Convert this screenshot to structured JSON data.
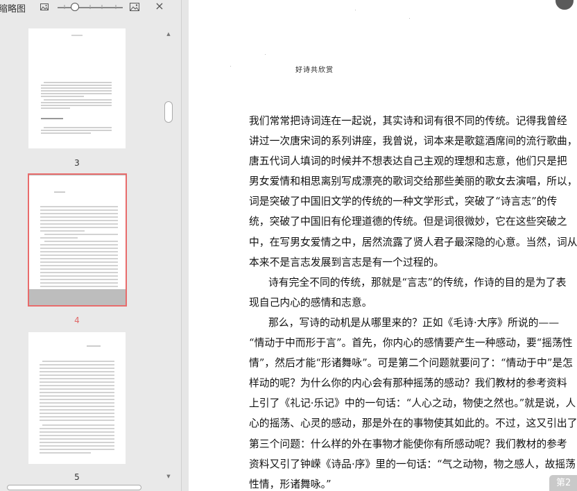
{
  "thumbnail_panel": {
    "title": "缩略图",
    "close_label": "×",
    "pages": [
      {
        "number": "3",
        "selected": false
      },
      {
        "number": "4",
        "selected": true
      },
      {
        "number": "5",
        "selected": false
      }
    ]
  },
  "document": {
    "running_header": "好诗共欣赏",
    "lines": [
      "我们常常把诗词连在一起说，其实诗和词有很不同的传统。记得我曾经",
      "讲过一次唐宋词的系列讲座，我曾说，词本来是歌筵酒席间的流行歌曲，",
      "唐五代词人填词的时候并不想表达自己主观的理想和志意，他们只是把",
      "男女爱情和相思离别写成漂亮的歌词交给那些美丽的歌女去演唱，所以，",
      "词是突破了中国旧文学的传统的一种文学形式，突破了“诗言志”的传",
      "统，突破了中国旧有伦理道德的传统。但是词很微妙，它在这些突破之",
      "中，在写男女爱情之中，居然流露了贤人君子最深隐的心意。当然，词从",
      "本来不是言志发展到言志是有一个过程的。",
      "诗有完全不同的传统，那就是“言志”的传统，作诗的目的是为了表",
      "现自己内心的感情和志意。",
      "那么，写诗的动机是从哪里来的？正如《毛诗·大序》所说的——",
      "“情动于中而形于言”。首先，你内心的感情要产生一种感动，要“摇荡性",
      "情”，然后才能“形诸舞咏”。可是第二个问题就要问了：“情动于中”是怎",
      "样动的呢？为什么你的内心会有那种摇荡的感动？我们教材的参考资料",
      "上引了《礼记·乐记》中的一句话：“人心之动，物使之然也。”就是说，人",
      "心的摇荡、心灵的感动，那是外在的事物使其如此的。不过，这又引出了",
      "第三个问题：什么样的外在事物才能使你有所感动呢？我们教材的参考",
      "资料又引了钟嵘《诗品·序》里的一句话：“气之动物，物之感人，故摇荡",
      "性情，形诸舞咏。”"
    ]
  },
  "page_badge": "第2"
}
